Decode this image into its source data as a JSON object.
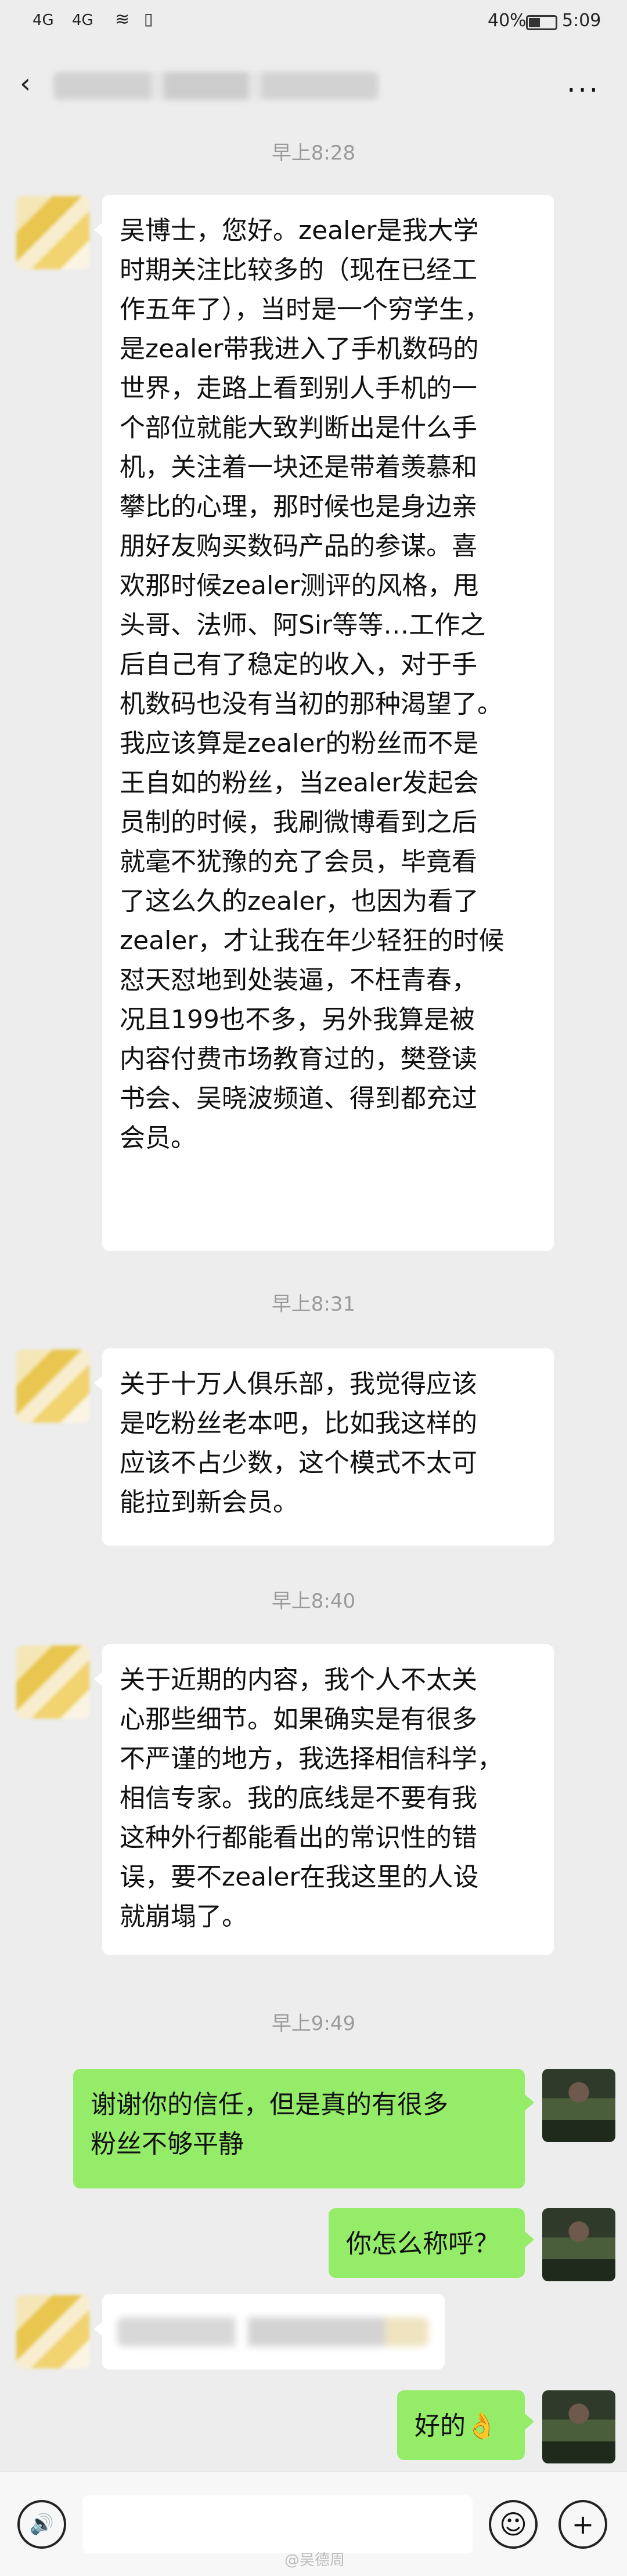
{
  "status_bar": {
    "signal_1": "4G",
    "signal_2": "4G",
    "battery_percent": "40%",
    "time": "5:09"
  },
  "nav": {
    "back_icon": "chevron-left-icon",
    "more_icon": "more-dots-icon",
    "more_label": "···"
  },
  "messages": [
    {
      "timestamp": "早上8:28",
      "side": "received",
      "text": "吴博士，您好。zealer是我大学\n时期关注比较多的（现在已经工\n作五年了），当时是一个穷学生，\n是zealer带我进入了手机数码的\n世界，走路上看到别人手机的一\n个部位就能大致判断出是什么手\n机，关注着一块还是带着羡慕和\n攀比的心理，那时候也是身边亲\n朋好友购买数码产品的参谋。喜\n欢那时候zealer测评的风格，甩\n头哥、法师、阿Sir等等…工作之\n后自己有了稳定的收入，对于手\n机数码也没有当初的那种渴望了。\n我应该算是zealer的粉丝而不是\n王自如的粉丝，当zealer发起会\n员制的时候，我刷微博看到之后\n就毫不犹豫的充了会员，毕竟看\n了这么久的zealer，也因为看了\nzealer，才让我在年少轻狂的时候\n怼天怼地到处装逼，不枉青春，\n况且199也不多，另外我算是被\n内容付费市场教育过的，樊登读\n书会、吴晓波频道、得到都充过\n会员。"
    },
    {
      "timestamp": "早上8:31",
      "side": "received",
      "text": "关于十万人俱乐部，我觉得应该\n是吃粉丝老本吧，比如我这样的\n应该不占少数，这个模式不太可\n能拉到新会员。"
    },
    {
      "timestamp": "早上8:40",
      "side": "received",
      "text": "关于近期的内容，我个人不太关\n心那些细节。如果确实是有很多\n不严谨的地方，我选择相信科学，\n相信专家。我的底线是不要有我\n这种外行都能看出的常识性的错\n误，要不zealer在我这里的人设\n就崩塌了。"
    },
    {
      "timestamp": "早上9:49",
      "side": "sent",
      "text": "谢谢你的信任，但是真的有很多\n粉丝不够平静"
    },
    {
      "side": "sent",
      "text": "你怎么称呼？"
    },
    {
      "side": "received",
      "text": ""
    },
    {
      "side": "sent",
      "text": "好的👌"
    }
  ],
  "input_bar": {
    "voice_icon": "voice-icon",
    "voice_glyph": "🔊",
    "emoji_icon": "emoji-icon",
    "emoji_glyph": "☺",
    "plus_icon": "plus-icon",
    "plus_glyph": "+"
  },
  "watermark": "@吴德周"
}
